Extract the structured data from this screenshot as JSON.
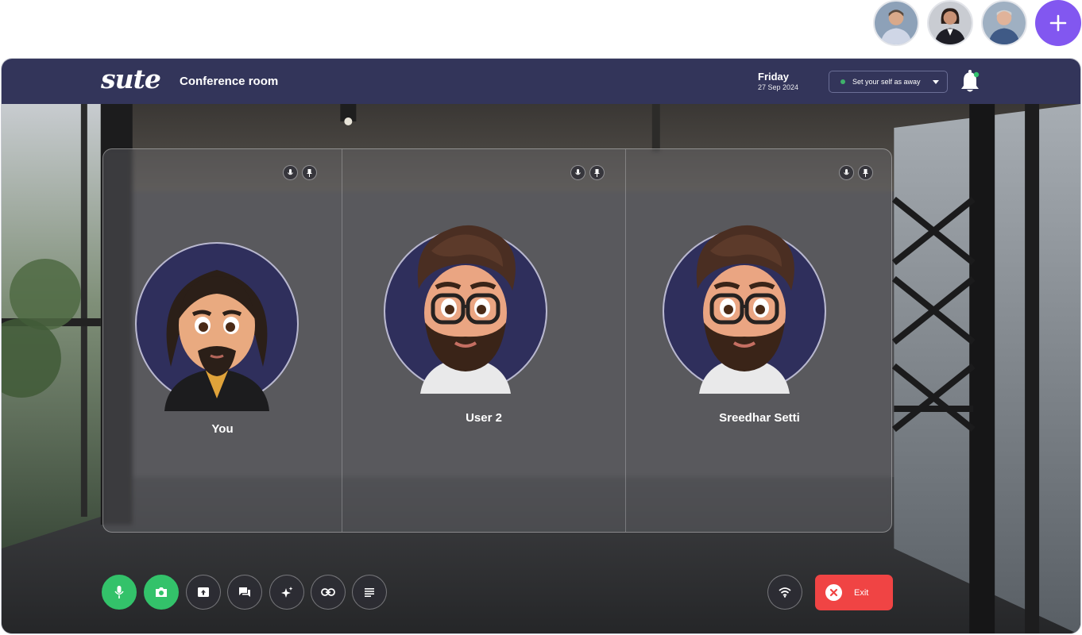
{
  "participants_strip": {
    "avatars": [
      {
        "name": "participant-avatar-1",
        "shirt": "#cfd6e6",
        "bg": "#8da1b8"
      },
      {
        "name": "participant-avatar-2",
        "shirt": "#1e1e26",
        "bg": "#c9ccd2"
      },
      {
        "name": "participant-avatar-3",
        "shirt": "#3f5a86",
        "bg": "#9fb0c2"
      }
    ],
    "add_icon": "plus-icon"
  },
  "header": {
    "logo": "sute",
    "room_title": "Conference room",
    "day": "Friday",
    "date": "27 Sep 2024",
    "status_label": "Set your self as away",
    "bell_icon": "bell-icon"
  },
  "tiles": [
    {
      "name": "You",
      "avatar": "long-hair-avatar",
      "icons": [
        "mic-icon",
        "pin-icon"
      ]
    },
    {
      "name": "User 2",
      "avatar": "glasses-avatar",
      "icons": [
        "mic-icon",
        "pin-icon"
      ]
    },
    {
      "name": "Sreedhar Setti",
      "avatar": "glasses-avatar",
      "icons": [
        "mic-icon",
        "pin-icon"
      ]
    }
  ],
  "controls": {
    "left": [
      "mic-icon",
      "camera-icon",
      "share-screen-icon",
      "chat-icon",
      "effects-icon",
      "link-icon",
      "notes-icon"
    ],
    "network_icon": "wifi-icon",
    "exit_label": "Exit"
  },
  "colors": {
    "header": "#33355a",
    "accent": "#8257f0",
    "active_control": "#33c26a",
    "exit": "#f04444",
    "avatar_circle": "#2f2f5c"
  }
}
